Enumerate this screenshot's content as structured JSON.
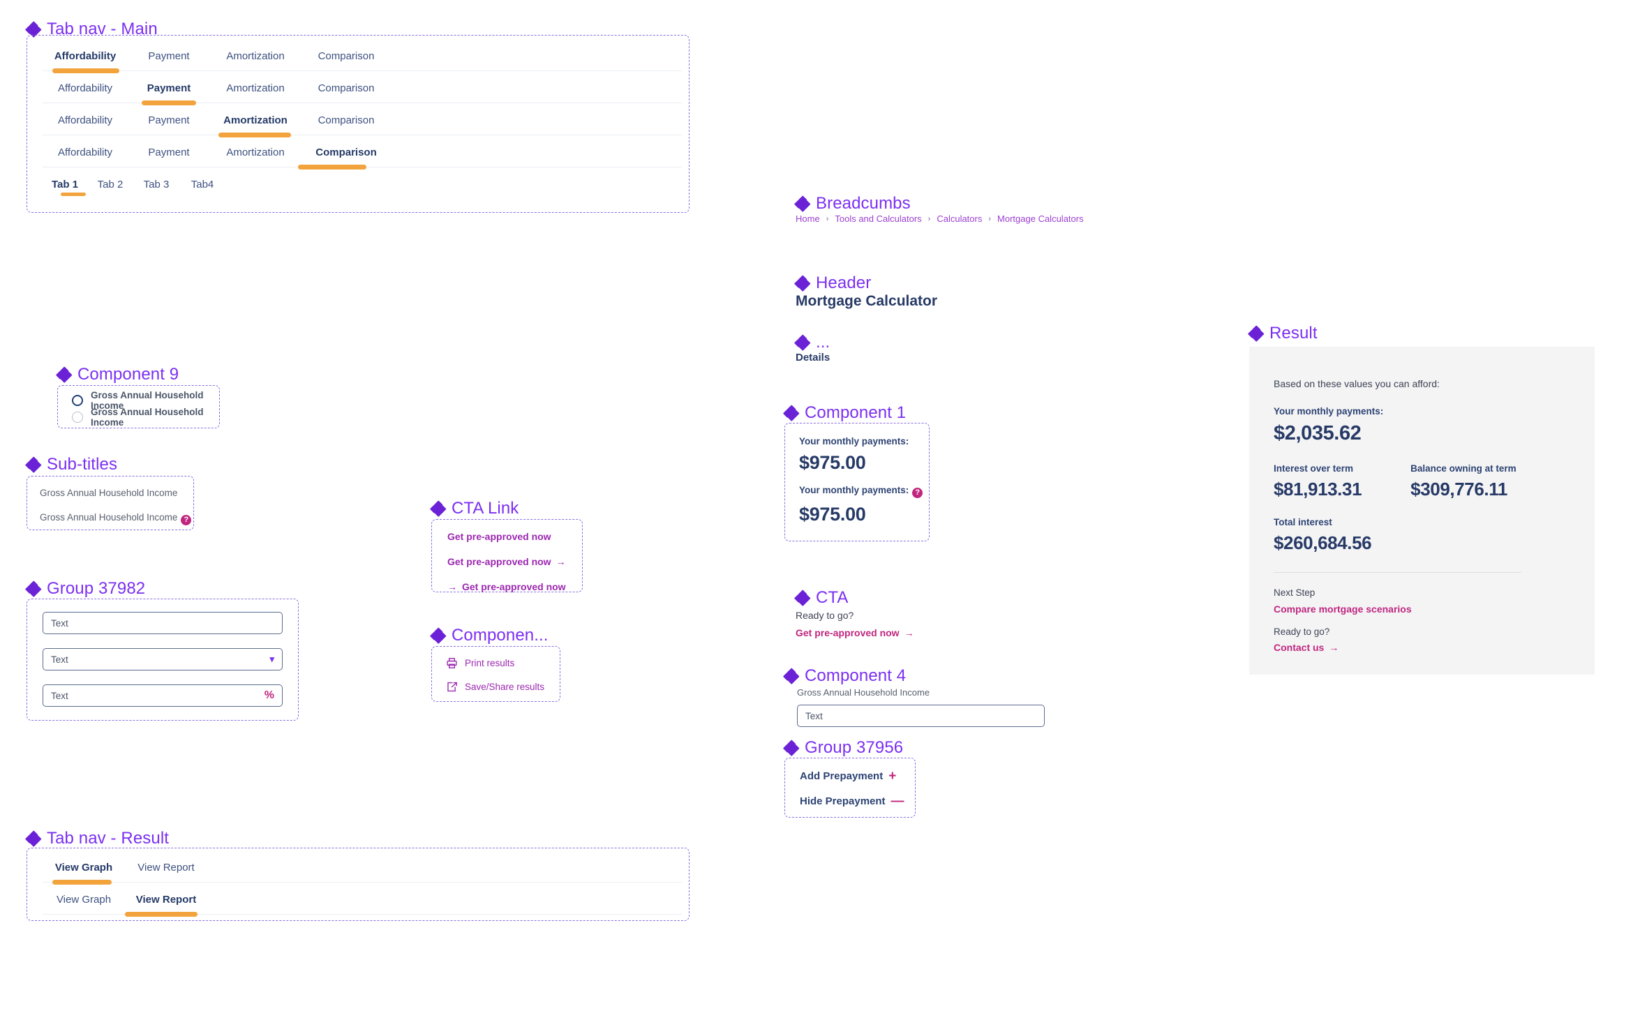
{
  "colors": {
    "accent_purple": "#7b2ff2",
    "icon_purple": "#6b21d6",
    "tab_underline_orange": "#f2a33c",
    "navy": "#273a66",
    "magenta": "#c0267f",
    "link_purple": "#9c27b0",
    "panel_bg": "#f4f4f5"
  },
  "tab_nav_main": {
    "title": "Tab nav - Main",
    "rows": [
      {
        "tabs": [
          "Affordability",
          "Payment",
          "Amortization",
          "Comparison"
        ],
        "active": 0
      },
      {
        "tabs": [
          "Affordability",
          "Payment",
          "Amortization",
          "Comparison"
        ],
        "active": 1
      },
      {
        "tabs": [
          "Affordability",
          "Payment",
          "Amortization",
          "Comparison"
        ],
        "active": 2
      },
      {
        "tabs": [
          "Affordability",
          "Payment",
          "Amortization",
          "Comparison"
        ],
        "active": 3
      }
    ],
    "generic_row": {
      "tabs": [
        "Tab 1",
        "Tab 2",
        "Tab 3",
        "Tab4"
      ],
      "active": 0
    }
  },
  "component9": {
    "title": "Component 9",
    "options": [
      {
        "label": "Gross Annual Household Income",
        "selected": true
      },
      {
        "label": "Gross Annual Household Income",
        "selected": false
      }
    ]
  },
  "subtitles": {
    "title": "Sub-titles",
    "items": [
      {
        "label": "Gross Annual Household Income",
        "help": false
      },
      {
        "label": "Gross Annual Household Income",
        "help": true,
        "help_glyph": "?"
      }
    ]
  },
  "group37982": {
    "title": "Group 37982",
    "fields": [
      {
        "value": "Text",
        "type": "text"
      },
      {
        "value": "Text",
        "type": "select",
        "chevron": "chevron-down"
      },
      {
        "value": "Text",
        "type": "percent",
        "suffix": "%"
      }
    ]
  },
  "cta_link": {
    "title": "CTA Link",
    "items": [
      {
        "label": "Get pre-approved now",
        "arrow": "none"
      },
      {
        "label": "Get pre-approved now",
        "arrow": "trailing",
        "glyph": "→"
      },
      {
        "label": "Get pre-approved now",
        "arrow": "leading",
        "glyph": "→"
      }
    ]
  },
  "component_utility": {
    "title": "Componen...",
    "items": [
      {
        "label": "Print results",
        "icon": "printer-icon"
      },
      {
        "label": "Save/Share results",
        "icon": "share-icon"
      }
    ]
  },
  "tab_nav_result": {
    "title": "Tab nav - Result",
    "rows": [
      {
        "tabs": [
          "View Graph",
          "View Report"
        ],
        "active": 0
      },
      {
        "tabs": [
          "View Graph",
          "View Report"
        ],
        "active": 1
      }
    ]
  },
  "breadcrumbs": {
    "title": "Breadcumbs",
    "items": [
      "Home",
      "Tools and Calculators",
      "Calculators",
      "Mortgage Calculators"
    ],
    "separator": "›"
  },
  "header": {
    "title": "Header",
    "page_title": "Mortgage Calculator",
    "secondary_title": "...",
    "details_label": "Details"
  },
  "component1": {
    "title": "Component 1",
    "rows": [
      {
        "label": "Your monthly payments:",
        "amount": "$975.00",
        "help": false
      },
      {
        "label": "Your monthly payments:",
        "amount": "$975.00",
        "help": true,
        "help_glyph": "?"
      }
    ]
  },
  "cta": {
    "title": "CTA",
    "prompt": "Ready to go?",
    "link": "Get pre-approved now",
    "arrow_glyph": "→"
  },
  "component4": {
    "title": "Component 4",
    "label": "Gross Annual Household Income",
    "field_value": "Text"
  },
  "group37956": {
    "title": "Group 37956",
    "items": [
      {
        "label": "Add Prepayment",
        "glyph": "+",
        "icon": "plus-icon"
      },
      {
        "label": "Hide Prepayment",
        "glyph": "—",
        "icon": "minus-icon"
      }
    ]
  },
  "result": {
    "title": "Result",
    "intro": "Based on these values you can afford:",
    "monthly_label": "Your monthly payments:",
    "monthly_value": "$2,035.62",
    "stats": [
      {
        "label": "Interest over term",
        "value": "$81,913.31"
      },
      {
        "label": "Balance owning at term",
        "value": "$309,776.11"
      }
    ],
    "total_label": "Total interest",
    "total_value": "$260,684.56",
    "next_step_label": "Next Step",
    "next_step_link": "Compare mortgage scenarios",
    "ready_label": "Ready to go?",
    "contact_link": "Contact us",
    "contact_arrow": "→"
  }
}
